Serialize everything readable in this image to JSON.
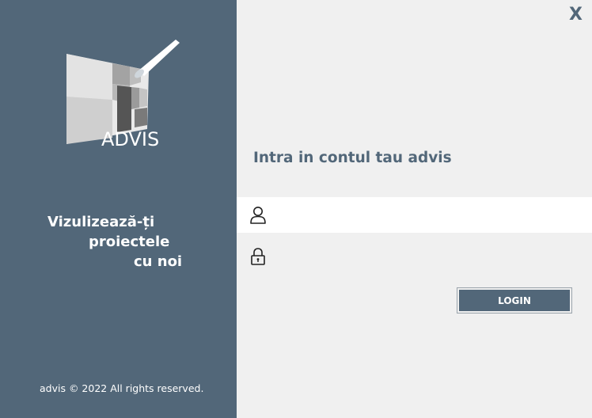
{
  "brand": {
    "name": "ADVIS",
    "tagline": [
      "Vizulizează-ți",
      "proiectele",
      "cu noi"
    ],
    "copyright": "advis © 2022 All rights reserved."
  },
  "window": {
    "close_label": "X"
  },
  "login": {
    "heading": "Intra in contul tau advis",
    "username": {
      "value": "",
      "placeholder": "",
      "icon": "user-icon"
    },
    "password": {
      "value": "",
      "placeholder": "",
      "icon": "lock-icon"
    },
    "submit_label": "LOGIN"
  },
  "colors": {
    "panel": "#526779",
    "background": "#f0f0f0",
    "field_active": "#ffffff",
    "text_light": "#ffffff"
  }
}
